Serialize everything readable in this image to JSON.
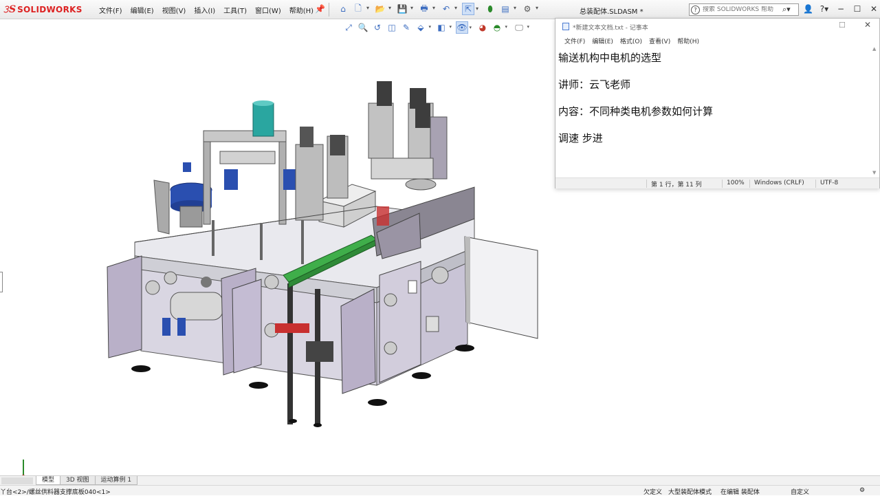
{
  "app": {
    "logo_text": "SOLIDWORKS",
    "document_title": "总装配体.SLDASM *"
  },
  "menu": [
    "文件(F)",
    "编辑(E)",
    "视图(V)",
    "插入(I)",
    "工具(T)",
    "窗口(W)",
    "帮助(H)"
  ],
  "toolbar_icons": [
    "home-icon",
    "new-document-icon",
    "open-icon",
    "save-icon",
    "print-icon",
    "undo-icon",
    "select-pointer-icon",
    "rebuild-icon",
    "file-properties-icon",
    "options-gear-icon"
  ],
  "help_search": {
    "placeholder": "搜索 SOLIDWORKS 帮助"
  },
  "view_toolbar_icons": [
    "zoom-to-fit-icon",
    "zoom-area-icon",
    "previous-view-icon",
    "section-view-icon",
    "dynamic-annotation-icon",
    "view-orientation-icon",
    "display-style-icon",
    "hide-show-items-icon",
    "edit-appearance-icon",
    "apply-scene-icon",
    "view-settings-icon"
  ],
  "notepad": {
    "title": "*新建文本文档.txt - 记事本",
    "menu": [
      "文件(F)",
      "编辑(E)",
      "格式(O)",
      "查看(V)",
      "帮助(H)"
    ],
    "lines": [
      "输送机构中电机的选型",
      "讲师：云飞老师",
      "内容：不同种类电机参数如何计算",
      "调速 步进"
    ],
    "status": {
      "position": "第 1 行，第 11 列",
      "zoom": "100%",
      "line_ending": "Windows (CRLF)",
      "encoding": "UTF-8"
    }
  },
  "bottom_tabs": [
    "模型",
    "3D 视图",
    "运动算例 1"
  ],
  "active_tab": "模型",
  "status_bar": {
    "left": "丫台<2>/螺丝供料器支撑底板040<1>",
    "fully_defined": "欠定义",
    "large_assembly": "大型装配体模式",
    "editing": "在编辑 装配体",
    "custom": "自定义"
  },
  "colors": {
    "accent_blue": "#3b6cc0",
    "logo_red": "#d22222",
    "conveyor_green": "#3fae4a",
    "motor_teal": "#2aa6a0",
    "hopper_blue": "#2a4fb0",
    "cabinet_lavender": "#b9b0c8",
    "frame_gray": "#9d9d9d"
  }
}
